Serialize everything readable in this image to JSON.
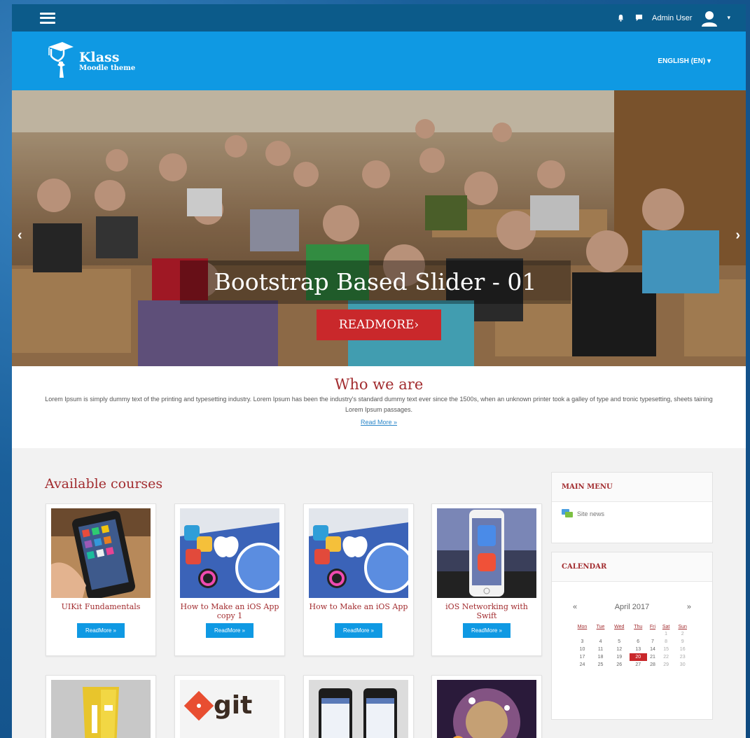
{
  "topbar": {
    "user_name": "Admin User"
  },
  "brand": {
    "title": "Klass",
    "subtitle": "Moodle theme",
    "language": "ENGLISH (EN)"
  },
  "slider": {
    "caption": "Bootstrap Based Slider - 01",
    "button_label": "READMORE›",
    "prev_glyph": "‹",
    "next_glyph": "›"
  },
  "who": {
    "title": "Who we are",
    "text": "Lorem Ipsum is simply dummy text of the printing and typesetting industry. Lorem Ipsum has been the industry's standard dummy text ever since the 1500s, when an unknown printer took a galley of type and tronic typesetting, sheets taining Lorem Ipsum passages.",
    "link": "Read More »"
  },
  "courses": {
    "title": "Available courses",
    "button_label": "ReadMore »",
    "items": [
      {
        "name": "UIKit Fundamentals"
      },
      {
        "name": "How to Make an iOS App copy 1"
      },
      {
        "name": "How to Make an iOS App"
      },
      {
        "name": "iOS Networking with Swift"
      }
    ]
  },
  "main_menu": {
    "title": "MAIN MENU",
    "item": "Site news"
  },
  "calendar": {
    "title": "CALENDAR",
    "prev": "«",
    "next": "»",
    "month": "April 2017",
    "days": [
      "Mon",
      "Tue",
      "Wed",
      "Thu",
      "Fri",
      "Sat",
      "Sun"
    ],
    "weeks": [
      [
        "",
        "",
        "",
        "",
        "",
        "1",
        "2"
      ],
      [
        "3",
        "4",
        "5",
        "6",
        "7",
        "8",
        "9"
      ],
      [
        "10",
        "11",
        "12",
        "13",
        "14",
        "15",
        "16"
      ],
      [
        "17",
        "18",
        "19",
        "20",
        "21",
        "22",
        "23"
      ],
      [
        "24",
        "25",
        "26",
        "27",
        "28",
        "29",
        "30"
      ]
    ],
    "today": "20"
  },
  "colors": {
    "topbar": "#0c5b8a",
    "brandbar": "#0f99e3",
    "accent_red": "#c9282b",
    "heading_red": "#a22c2f"
  }
}
